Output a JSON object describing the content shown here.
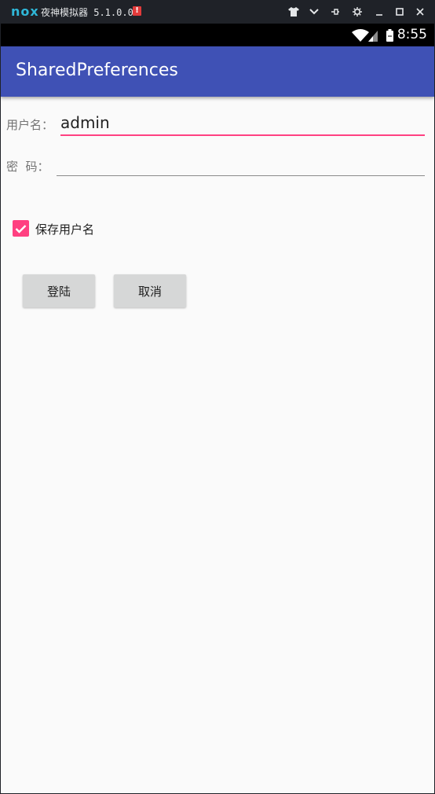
{
  "emulator": {
    "logo": "nox",
    "title": "夜神模拟器 5.1.0.0",
    "badge": "!"
  },
  "status_bar": {
    "time": "8:55"
  },
  "app_bar": {
    "title": "SharedPreferences"
  },
  "form": {
    "username_label": "用户名：",
    "username_value": "admin",
    "password_label": "密  码：",
    "password_value": "",
    "remember_label": "保存用户名",
    "remember_checked": true,
    "login_button": "登陆",
    "cancel_button": "取消"
  },
  "colors": {
    "app_bar": "#3f51b5",
    "accent": "#ff4081",
    "background": "#fafafa"
  }
}
